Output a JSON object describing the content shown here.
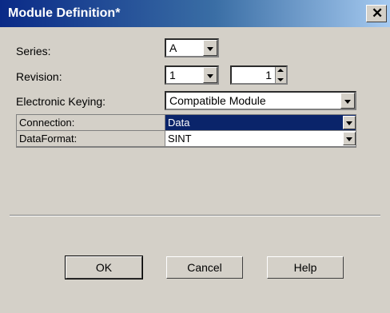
{
  "window": {
    "title": "Module Definition*",
    "close_glyph": "✕"
  },
  "series": {
    "label": "Series:",
    "value": "A"
  },
  "revision": {
    "label": "Revision:",
    "major": "1",
    "minor": "1"
  },
  "keying": {
    "label": "Electronic Keying:",
    "value": "Compatible Module"
  },
  "grid": {
    "rows": [
      {
        "label": "Connection:",
        "value": "Data"
      },
      {
        "label": "DataFormat:",
        "value": "SINT"
      }
    ]
  },
  "buttons": {
    "ok": "OK",
    "cancel": "Cancel",
    "help": "Help"
  },
  "colors": {
    "selection": "#0a246a",
    "titlebar_start": "#0a2a87",
    "dialog_face": "#d4d0c8"
  }
}
